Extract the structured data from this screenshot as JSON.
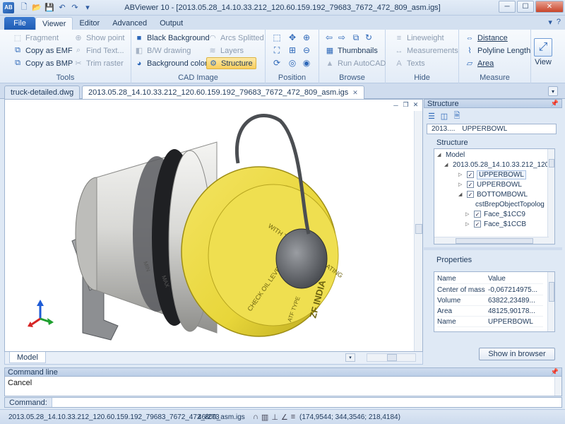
{
  "window": {
    "app_logo": "AB",
    "title": "ABViewer 10 - [2013.05.28_14.10.33.212_120.60.159.192_79683_7672_472_809_asm.igs]",
    "minimize": "─",
    "maximize": "☐",
    "close": "✕"
  },
  "qat": {
    "new": "🗋",
    "open": "📂",
    "save": "💾",
    "undo": "↶",
    "redo": "↷",
    "more": "▾"
  },
  "ribbon_tabs": [
    "File",
    "Viewer",
    "Editor",
    "Advanced",
    "Output"
  ],
  "ribbon_right": {
    "menu": "▾",
    "help": "?"
  },
  "groups": {
    "tools": {
      "label": "Tools",
      "fragment": "Fragment",
      "copy_emf": "Copy as EMF",
      "copy_bmp": "Copy as BMP",
      "show_point": "Show point",
      "find_text": "Find Text...",
      "trim_raster": "Trim raster"
    },
    "cad_image": {
      "label": "CAD Image",
      "black_background": "Black Background",
      "bw_drawing": "B/W drawing",
      "background_color": "Background color",
      "arcs_splitted": "Arcs Splitted",
      "layers": "Layers",
      "structure": "Structure"
    },
    "position": {
      "label": "Position"
    },
    "browse": {
      "label": "Browse",
      "thumbnails": "Thumbnails",
      "run_autocad": "Run AutoCAD"
    },
    "hide": {
      "label": "Hide",
      "lineweight": "Lineweight",
      "measurements": "Measurements",
      "texts": "Texts"
    },
    "measure": {
      "label": "Measure",
      "distance": "Distance",
      "polyline_length": "Polyline Length",
      "area": "Area"
    },
    "view": {
      "label": "View"
    }
  },
  "doc_tabs": [
    {
      "label": "truck-detailed.dwg"
    },
    {
      "label": "2013.05.28_14.10.33.212_120.60.159.192_79683_7672_472_809_asm.igs"
    }
  ],
  "viewport": {
    "cap_text_1": "WITH THE PUMP OPERATING",
    "cap_text_2": "CHECK OIL LEVEL",
    "cap_text_3": "ATF TYPE",
    "cap_brand": "ZF INDIA",
    "body_text_1": "MAX",
    "body_text_2": "MIN",
    "colors": {
      "cap": "#e8d63a",
      "body": "#d9d9d6",
      "bracket": "#8d8f92"
    }
  },
  "model_tab": "Model",
  "structure_panel": {
    "title": "Structure",
    "tab_file": "2013....",
    "tab_name": "UPPERBOWL",
    "frame_label": "Structure",
    "tree": [
      {
        "label": "Model",
        "indent": 0
      },
      {
        "label": "2013.05.28_14.10.33.212_120.6",
        "indent": 1
      },
      {
        "label": "UPPERBOWL",
        "indent": 2,
        "checked": true,
        "selected": true
      },
      {
        "label": "UPPERBOWL",
        "indent": 2,
        "checked": true
      },
      {
        "label": "BOTTOMBOWL",
        "indent": 2,
        "checked": true
      },
      {
        "label": "cstBrepObjectTopolog",
        "indent": 3
      },
      {
        "label": "Face_$1CC9",
        "indent": 3,
        "checked": true
      },
      {
        "label": "Face_$1CCB",
        "indent": 3,
        "checked": true
      }
    ]
  },
  "properties_panel": {
    "title": "Properties",
    "headers": {
      "name": "Name",
      "value": "Value"
    },
    "rows": [
      {
        "name": "Center of mass",
        "value": "-0,067214975..."
      },
      {
        "name": "Volume",
        "value": "63822,23489..."
      },
      {
        "name": "Area",
        "value": "48125,90178..."
      },
      {
        "name": "Name",
        "value": "UPPERBOWL"
      }
    ],
    "show_in_browser": "Show in browser"
  },
  "command": {
    "title": "Command line",
    "output": "Cancel",
    "input_label": "Command:",
    "input_value": ""
  },
  "status": {
    "file": "2013.05.28_14.10.33.212_120.60.159.192_79683_7672_472_809_asm.igs",
    "count": "46/273",
    "coords": "(174,9544; 344,3546; 218,4184)"
  }
}
